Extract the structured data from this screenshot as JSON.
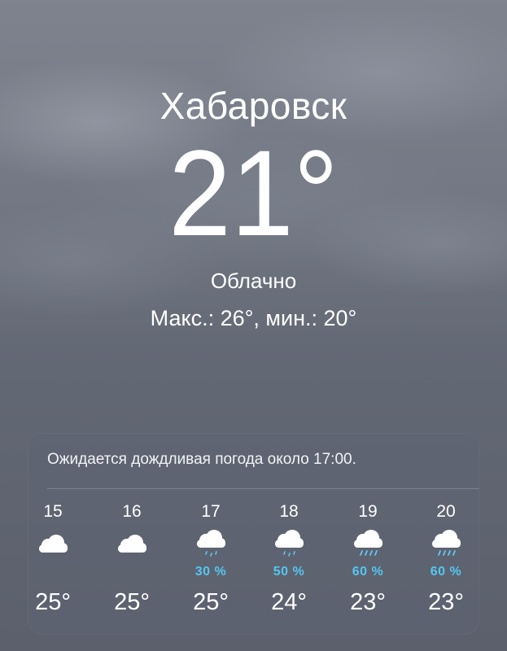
{
  "location": {
    "city": "Хабаровск",
    "temperature": "21°",
    "condition": "Облачно",
    "high_low": "Макс.: 26°, мин.: 20°"
  },
  "hourly": {
    "note": "Ожидается дождливая погода около 17:00.",
    "items": [
      {
        "time": "15",
        "icon": "cloud-icon",
        "precip": "",
        "temp": "25°"
      },
      {
        "time": "16",
        "icon": "cloud-icon",
        "precip": "",
        "temp": "25°"
      },
      {
        "time": "17",
        "icon": "cloud-light-rain-icon",
        "precip": "30 %",
        "temp": "25°"
      },
      {
        "time": "18",
        "icon": "cloud-light-rain-icon",
        "precip": "50 %",
        "temp": "24°"
      },
      {
        "time": "19",
        "icon": "cloud-rain-icon",
        "precip": "60 %",
        "temp": "23°"
      },
      {
        "time": "20",
        "icon": "cloud-rain-icon",
        "precip": "60 %",
        "temp": "23°"
      }
    ]
  },
  "colors": {
    "precip_text": "#54c6f0",
    "rain_drops": "#5fc8f2",
    "cloud": "#ffffff"
  }
}
